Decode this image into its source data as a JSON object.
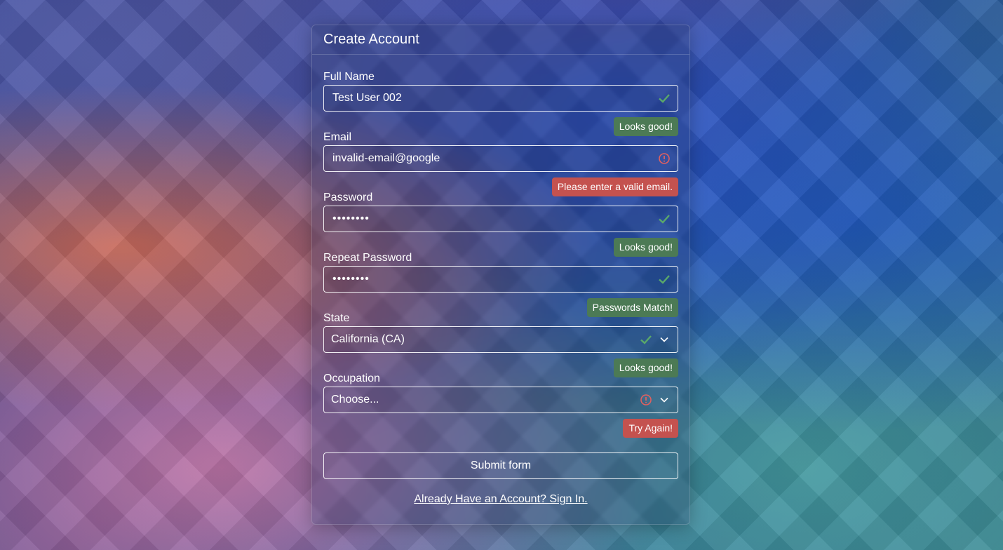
{
  "form": {
    "title": "Create Account",
    "fields": [
      {
        "label": "Full Name",
        "value": "Test User 002",
        "status": "valid",
        "feedback": "Looks good!"
      },
      {
        "label": "Email",
        "value": "invalid-email@google",
        "status": "invalid",
        "feedback": "Please enter a valid email."
      },
      {
        "label": "Password",
        "value": "••••••••",
        "status": "valid",
        "feedback": "Looks good!"
      },
      {
        "label": "Repeat Password",
        "value": "••••••••",
        "status": "valid",
        "feedback": "Passwords Match!"
      },
      {
        "label": "State",
        "value": "California (CA)",
        "status": "valid",
        "feedback": "Looks good!"
      },
      {
        "label": "Occupation",
        "value": "Choose...",
        "status": "invalid",
        "feedback": "Try Again!"
      }
    ],
    "submit_label": "Submit form",
    "signin_link": "Already Have an Account? Sign In."
  },
  "colors": {
    "valid": "#4c7a55",
    "invalid": "#c4524f",
    "valid_icon": "#5aa86a",
    "invalid_icon": "#e06060"
  },
  "icons": {
    "valid": "check-icon",
    "invalid": "alert-circle-icon",
    "dropdown": "chevron-down-icon"
  }
}
